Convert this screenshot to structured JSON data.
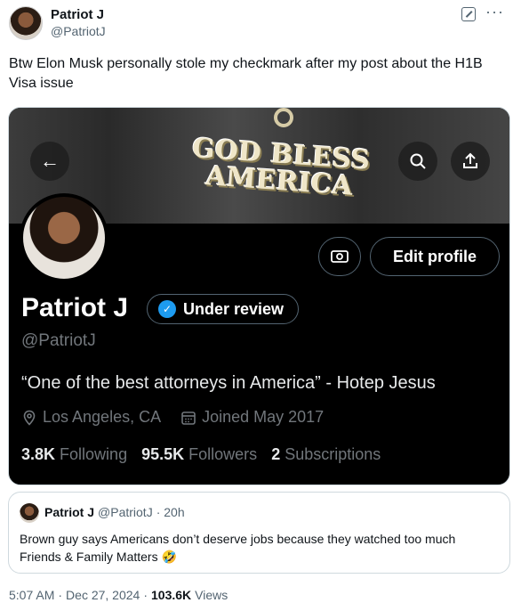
{
  "tweet": {
    "author_name": "Patriot J",
    "author_handle": "@PatriotJ",
    "text": "Btw Elon Musk personally stole my checkmark after my post about the H1B Visa issue",
    "time": "5:07 AM",
    "date": "Dec 27, 2024",
    "views_count": "103.6K",
    "views_label": "Views"
  },
  "screenshot": {
    "banner_text": "GOD BLESS AMERICA",
    "edit_profile_label": "Edit profile",
    "name": "Patriot J",
    "verification_label": "Under review",
    "handle": "@PatriotJ",
    "bio": "“One of the best attorneys in America” - Hotep Jesus",
    "location": "Los Angeles, CA",
    "joined": "Joined May 2017",
    "following_count": "3.8K",
    "following_label": "Following",
    "followers_count": "95.5K",
    "followers_label": "Followers",
    "subscriptions_count": "2",
    "subscriptions_label": "Subscriptions"
  },
  "quote": {
    "author_name": "Patriot J",
    "author_handle": "@PatriotJ",
    "time": "· 20h",
    "text": "Brown guy says Americans don’t deserve jobs because they watched too much Friends & Family Matters 🤣"
  },
  "colors": {
    "accent": "#1d9bf0",
    "text_primary": "#0f1419",
    "text_secondary": "#536471"
  },
  "icons": [
    "avatar",
    "grok-icon",
    "more-icon",
    "back-arrow-icon",
    "search-icon",
    "share-icon",
    "money-icon",
    "verified-badge-icon",
    "location-icon",
    "calendar-icon"
  ]
}
